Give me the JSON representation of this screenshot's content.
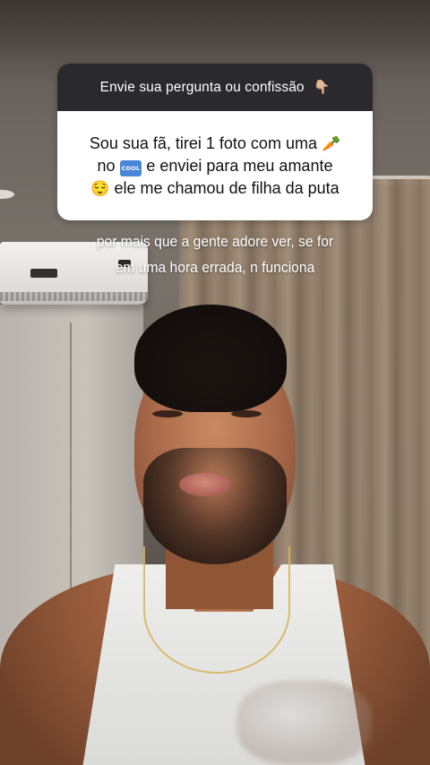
{
  "question_sticker": {
    "header_text": "Envie sua pergunta ou confissão",
    "header_icon": "pointing-down-emoji",
    "header_icon_glyph": "👇🏼",
    "answer": {
      "part1": "Sou sua fã, tirei 1 foto com uma",
      "emoji_carrot": "🥕",
      "part2": "no",
      "cool_badge": "COOL",
      "part3": "e enviei para meu amante",
      "emoji_relieved": "😌",
      "part4": "ele me chamou de filha da puta"
    }
  },
  "caption": {
    "line1": "por mais que a gente adore ver, se for",
    "line2": "em uma hora errada, n funciona"
  },
  "colors": {
    "sticker_header": "#2a2a2e",
    "sticker_body": "#ffffff",
    "caption_text": "#ffffff",
    "cool_badge": "#4a86d8"
  }
}
